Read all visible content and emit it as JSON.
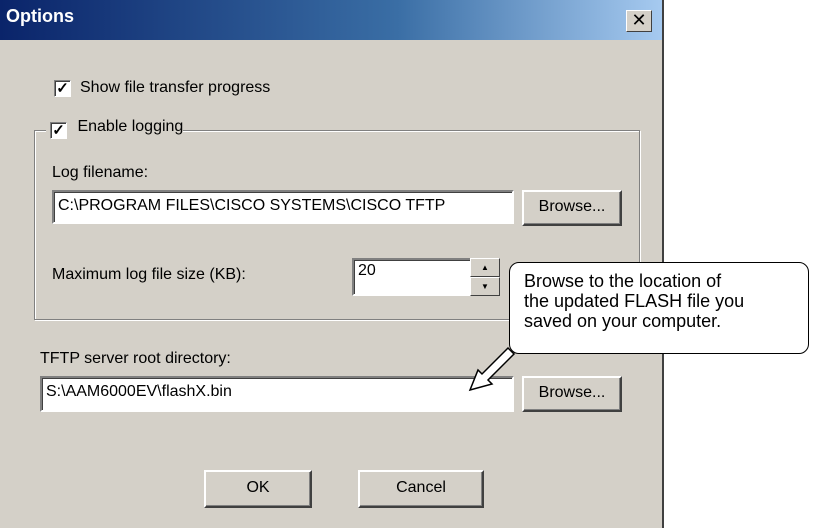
{
  "window": {
    "title": "Options"
  },
  "options": {
    "show_progress": {
      "label": "Show file transfer progress",
      "checked": true
    },
    "enable_logging": {
      "label": "Enable logging",
      "checked": true
    },
    "log_filename": {
      "label": "Log filename:",
      "value": "C:\\PROGRAM FILES\\CISCO SYSTEMS\\CISCO TFTP",
      "browse": "Browse..."
    },
    "max_log_size": {
      "label": "Maximum log file size (KB):",
      "value": "20"
    },
    "root_dir": {
      "label": "TFTP server root directory:",
      "value": "S:\\AAM6000EV\\flashX.bin",
      "browse": "Browse..."
    }
  },
  "buttons": {
    "ok": "OK",
    "cancel": "Cancel"
  },
  "callout": {
    "line1": "Browse to the location of",
    "line2": "the updated FLASH file you",
    "line3": "saved on your computer."
  },
  "icons": {
    "close": "close-icon",
    "checkmark": "checkmark-icon",
    "spin_up": "arrow-up-icon",
    "spin_down": "arrow-down-icon",
    "pointer": "arrow-pointer-icon"
  }
}
